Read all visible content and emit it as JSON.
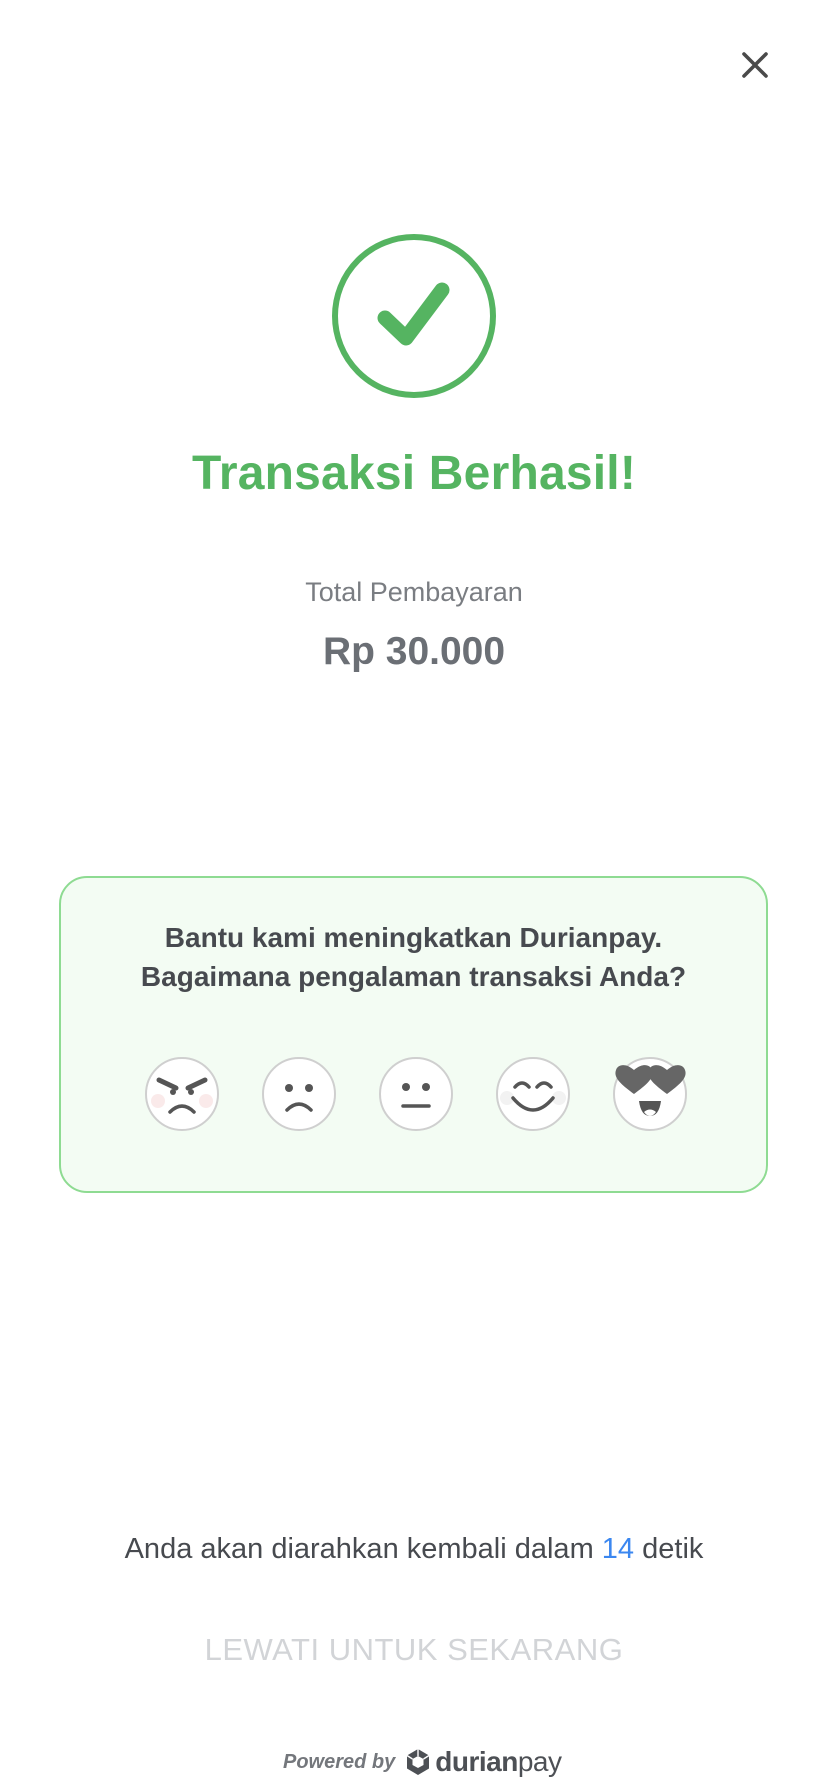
{
  "header": {
    "close_icon": "close-icon"
  },
  "status": {
    "icon": "check-circle-icon",
    "title": "Transaksi Berhasil!",
    "color": "#55b461"
  },
  "payment": {
    "label": "Total Pembayaran",
    "amount": "Rp 30.000"
  },
  "feedback": {
    "line1": "Bantu kami meningkatkan Durianpay.",
    "line2": "Bagaimana pengalaman transaksi Anda?",
    "emojis": [
      "angry-face-icon",
      "sad-face-icon",
      "neutral-face-icon",
      "smiling-face-icon",
      "heart-eyes-face-icon"
    ],
    "border_color": "#8edb92",
    "background_color": "#f3fcf3"
  },
  "redirect": {
    "prefix": "Anda akan diarahkan kembali dalam",
    "seconds": "14",
    "suffix": "detik",
    "accent_color": "#3b87f0"
  },
  "skip_label": "LEWATI UNTUK SEKARANG",
  "footer": {
    "powered_by": "Powered by",
    "brand_bold": "durian",
    "brand_regular": "pay",
    "logo_icon": "durianpay-logo-icon"
  }
}
